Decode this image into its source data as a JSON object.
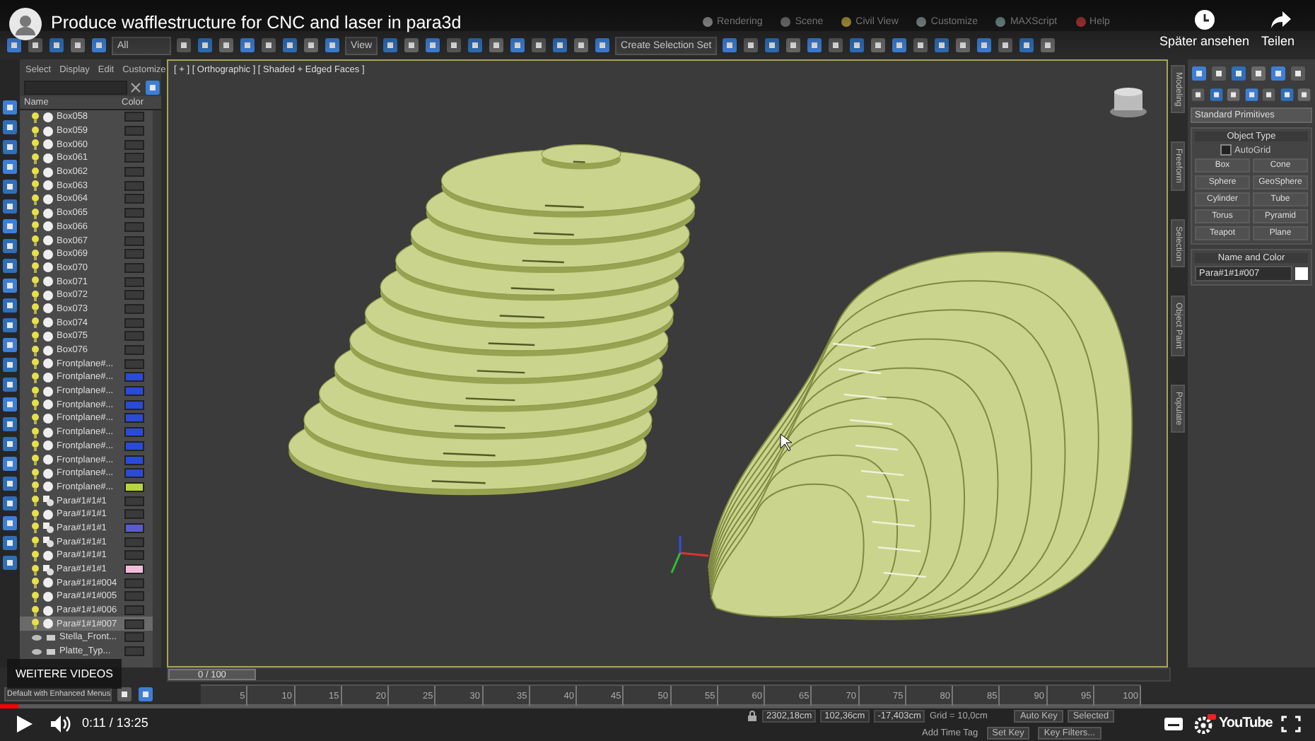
{
  "video_overlay": {
    "title": "Produce wafflestructure for CNC and laser in para3d",
    "watch_later": "Später ansehen",
    "share": "Teilen",
    "more_videos": "WEITERE VIDEOS",
    "progress": {
      "level": 0.014
    },
    "time": "0:11 / 13:25",
    "logo": "YouTube"
  },
  "menu_bar": [
    "Rendering",
    "Scene",
    "Civil View",
    "Customize",
    "MAXScript",
    "Help"
  ],
  "toolbar": {
    "selection_filter": "All",
    "reference_coordinate": "View",
    "selection_set": "Create Selection Set"
  },
  "scene_explorer": {
    "menu": [
      "Select",
      "Display",
      "Edit",
      "Customize"
    ],
    "columns": [
      "Name",
      "Color"
    ],
    "rows": [
      {
        "name": "Box058",
        "kind": "object",
        "color": "#3a3a3a",
        "selected": false
      },
      {
        "name": "Box059",
        "kind": "object",
        "color": "#3a3a3a",
        "selected": false
      },
      {
        "name": "Box060",
        "kind": "object",
        "color": "#3a3a3a",
        "selected": false
      },
      {
        "name": "Box061",
        "kind": "object",
        "color": "#3a3a3a",
        "selected": false
      },
      {
        "name": "Box062",
        "kind": "object",
        "color": "#3a3a3a",
        "selected": false
      },
      {
        "name": "Box063",
        "kind": "object",
        "color": "#3a3a3a",
        "selected": false
      },
      {
        "name": "Box064",
        "kind": "object",
        "color": "#3a3a3a",
        "selected": false
      },
      {
        "name": "Box065",
        "kind": "object",
        "color": "#3a3a3a",
        "selected": false
      },
      {
        "name": "Box066",
        "kind": "object",
        "color": "#3a3a3a",
        "selected": false
      },
      {
        "name": "Box067",
        "kind": "object",
        "color": "#3a3a3a",
        "selected": false
      },
      {
        "name": "Box069",
        "kind": "object",
        "color": "#3a3a3a",
        "selected": false
      },
      {
        "name": "Box070",
        "kind": "object",
        "color": "#3a3a3a",
        "selected": false
      },
      {
        "name": "Box071",
        "kind": "object",
        "color": "#3a3a3a",
        "selected": false
      },
      {
        "name": "Box072",
        "kind": "object",
        "color": "#3a3a3a",
        "selected": false
      },
      {
        "name": "Box073",
        "kind": "object",
        "color": "#3a3a3a",
        "selected": false
      },
      {
        "name": "Box074",
        "kind": "object",
        "color": "#3a3a3a",
        "selected": false
      },
      {
        "name": "Box075",
        "kind": "object",
        "color": "#3a3a3a",
        "selected": false
      },
      {
        "name": "Box076",
        "kind": "object",
        "color": "#3a3a3a",
        "selected": false
      },
      {
        "name": "Frontplane#...",
        "kind": "object",
        "color": "#3a3a3a",
        "selected": false
      },
      {
        "name": "Frontplane#...",
        "kind": "object",
        "color": "#2a4ad8",
        "selected": false
      },
      {
        "name": "Frontplane#...",
        "kind": "object",
        "color": "#2a4ad8",
        "selected": false
      },
      {
        "name": "Frontplane#...",
        "kind": "object",
        "color": "#2a4ad8",
        "selected": false
      },
      {
        "name": "Frontplane#...",
        "kind": "object",
        "color": "#2a4ad8",
        "selected": false
      },
      {
        "name": "Frontplane#...",
        "kind": "object",
        "color": "#2a4ad8",
        "selected": false
      },
      {
        "name": "Frontplane#...",
        "kind": "object",
        "color": "#2a4ad8",
        "selected": false
      },
      {
        "name": "Frontplane#...",
        "kind": "object",
        "color": "#2a4ad8",
        "selected": false
      },
      {
        "name": "Frontplane#...",
        "kind": "object",
        "color": "#2a4ad8",
        "selected": false
      },
      {
        "name": "Frontplane#...",
        "kind": "object",
        "color": "#b8d43c",
        "selected": false
      },
      {
        "name": "Para#1#1#1",
        "kind": "group",
        "color": "#3a3a3a",
        "selected": false
      },
      {
        "name": "Para#1#1#1",
        "kind": "object",
        "color": "#3a3a3a",
        "selected": false
      },
      {
        "name": "Para#1#1#1",
        "kind": "group",
        "color": "#5a5ad8",
        "selected": false
      },
      {
        "name": "Para#1#1#1",
        "kind": "group",
        "color": "#3a3a3a",
        "selected": false
      },
      {
        "name": "Para#1#1#1",
        "kind": "object",
        "color": "#3a3a3a",
        "selected": false
      },
      {
        "name": "Para#1#1#1",
        "kind": "group",
        "color": "#f2bcdc",
        "selected": false
      },
      {
        "name": "Para#1#1#004",
        "kind": "object",
        "color": "#3a3a3a",
        "selected": false
      },
      {
        "name": "Para#1#1#005",
        "kind": "object",
        "color": "#3a3a3a",
        "selected": false
      },
      {
        "name": "Para#1#1#006",
        "kind": "object",
        "color": "#3a3a3a",
        "selected": false
      },
      {
        "name": "Para#1#1#007",
        "kind": "object",
        "color": "#3a3a3a",
        "selected": true
      },
      {
        "name": "Stella_Front...",
        "kind": "layer",
        "color": "#3a3a3a",
        "selected": false
      },
      {
        "name": "Platte_Typ...",
        "kind": "layer",
        "color": "#3a3a3a",
        "selected": false
      }
    ]
  },
  "viewport": {
    "label": "[ + ] [ Orthographic ] [ Shaded + Edged Faces ]"
  },
  "side_tabs": [
    "Modeling",
    "Freeform",
    "Selection",
    "Object Paint",
    "Populate"
  ],
  "command_panel": {
    "category": "Standard Primitives",
    "object_type": {
      "title": "Object Type",
      "autogrid": {
        "label": "AutoGrid",
        "checked": false
      },
      "buttons": [
        "Box",
        "Cone",
        "Sphere",
        "GeoSphere",
        "Cylinder",
        "Tube",
        "Torus",
        "Pyramid",
        "Teapot",
        "Plane"
      ]
    },
    "name_and_color": {
      "title": "Name and Color",
      "name": "Para#1#1#007",
      "color": "#ffffff"
    }
  },
  "workspace": "Default with Enhanced Menus",
  "timeline": {
    "frame": "0 / 100",
    "level": 0,
    "ticks": [
      "5",
      "10",
      "15",
      "20",
      "25",
      "30",
      "35",
      "40",
      "45",
      "50",
      "55",
      "60",
      "65",
      "70",
      "75",
      "80",
      "85",
      "90",
      "95",
      "100"
    ]
  },
  "status_bar": {
    "x": "2302,18cm",
    "y": "102,36cm",
    "z": "-17,403cm",
    "grid": "Grid = 10,0cm",
    "add_time_tag": "Add Time Tag",
    "auto_key": "Auto Key",
    "key_mode": "Selected",
    "set_key": "Set Key",
    "key_filters": "Key Filters..."
  }
}
